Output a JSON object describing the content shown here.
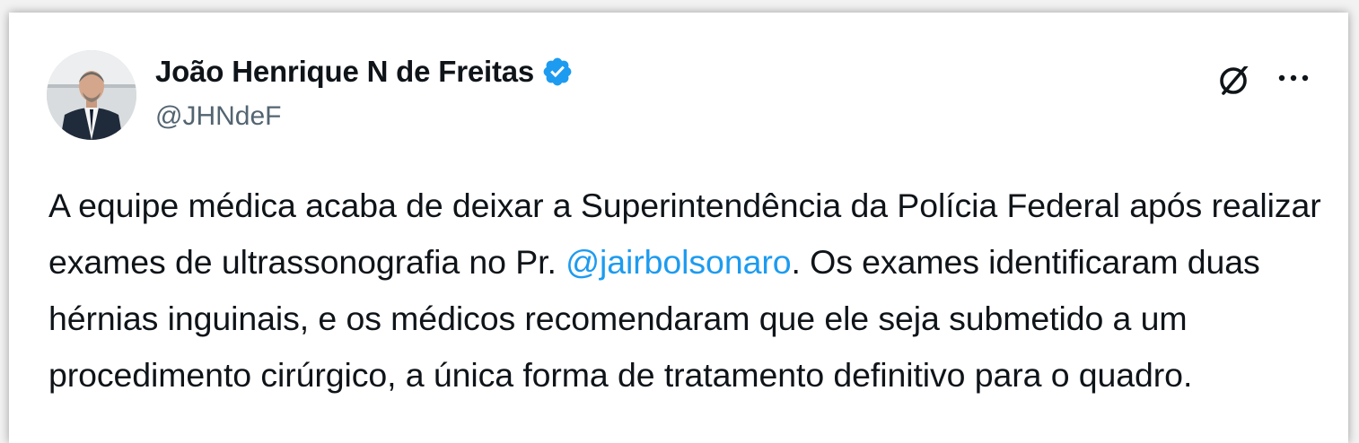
{
  "author": {
    "display_name": "João Henrique N de Freitas",
    "handle": "@JHNdeF",
    "verified": true,
    "verified_color": "#1d9bf0"
  },
  "actions": {
    "grok_icon": "grok-icon",
    "more_icon": "more-options-icon"
  },
  "tweet": {
    "text_before_mention": "A equipe médica acaba de deixar a Superintendência da Polícia Federal após realizar exames de ultrassonografia no Pr. ",
    "mention": "@jairbolsonaro",
    "text_after_mention": ". Os exames identificaram duas hérnias inguinais, e os médicos recomendaram que ele seja submetido a um procedimento cirúrgico, a única forma de tratamento definitivo para o quadro."
  },
  "colors": {
    "text": "#0f1419",
    "secondary": "#536471",
    "link": "#1d9bf0"
  }
}
